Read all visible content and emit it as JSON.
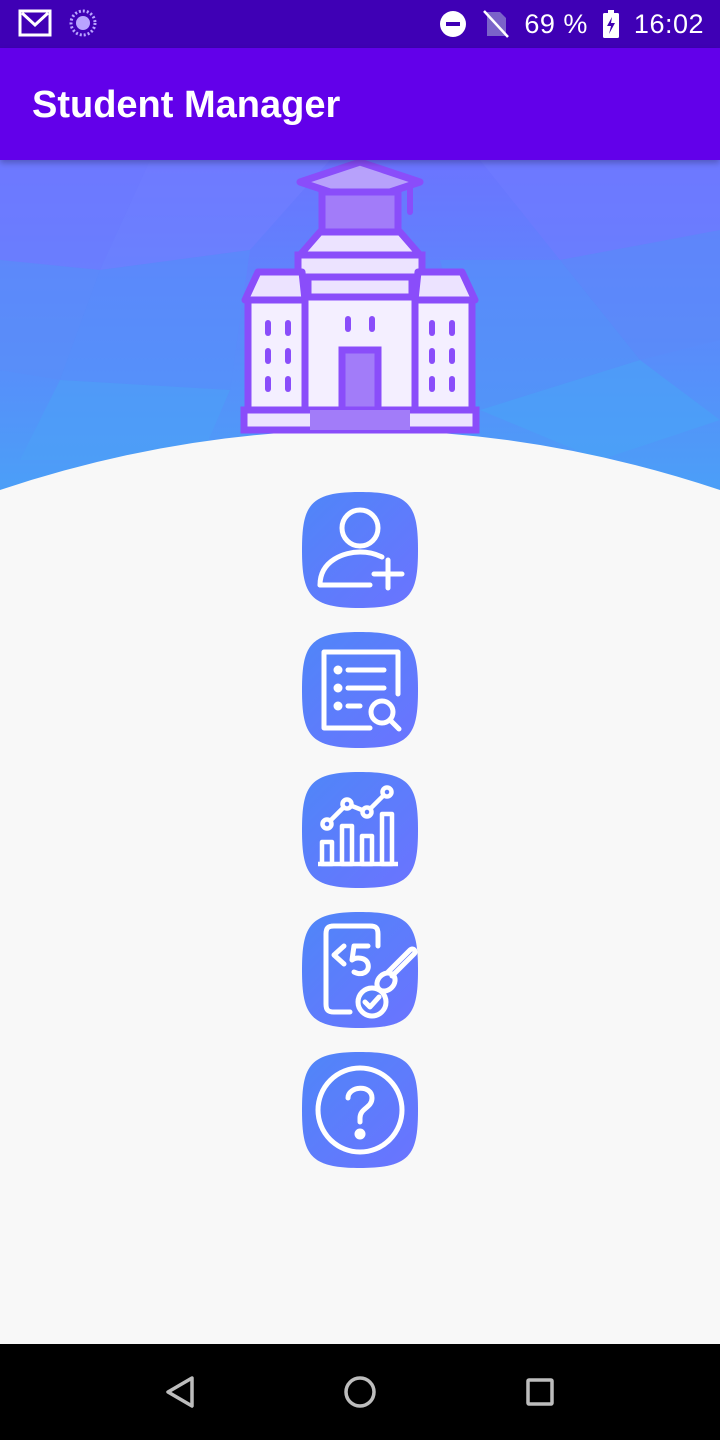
{
  "status_bar": {
    "battery_percent": "69 %",
    "time": "16:02",
    "icons": [
      "gmail-icon",
      "loading-icon",
      "do-not-disturb-icon",
      "no-sim-icon",
      "battery-charging-icon"
    ]
  },
  "app_bar": {
    "title": "Student Manager"
  },
  "header": {
    "illustration": "university-building-icon"
  },
  "menu": {
    "items": [
      {
        "icon": "add-student-icon"
      },
      {
        "icon": "search-list-icon"
      },
      {
        "icon": "statistics-chart-icon"
      },
      {
        "icon": "grade-check-icon"
      },
      {
        "icon": "help-icon"
      }
    ]
  },
  "nav_bar": {
    "buttons": [
      "back-icon",
      "home-icon",
      "recents-icon"
    ]
  },
  "colors": {
    "status_bar": "#3f00b5",
    "app_bar": "#6200ea",
    "accent_gradient_start": "#4f7df8",
    "accent_gradient_end": "#6b73ff",
    "background": "#f8f8f8",
    "building_purple": "#8a4dfa"
  }
}
